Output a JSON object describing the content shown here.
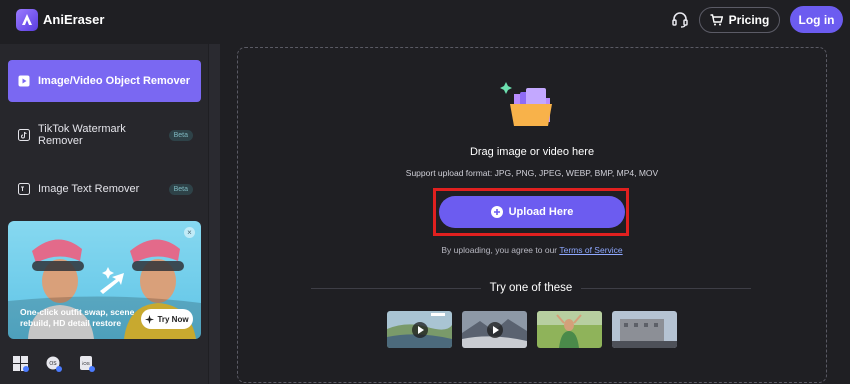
{
  "header": {
    "brand": "AniEraser",
    "pricing_label": "Pricing",
    "login_label": "Log in"
  },
  "sidebar": {
    "items": [
      {
        "label": "Image/Video Object Remover",
        "badge": "",
        "active": true
      },
      {
        "label": "TikTok Watermark Remover",
        "badge": "Beta",
        "active": false
      },
      {
        "label": "Image Text Remover",
        "badge": "Beta",
        "active": false
      }
    ],
    "promo": {
      "text": "One-click outfit swap, scene rebuild, HD detail restore",
      "button_label": "Try Now",
      "close_symbol": "×"
    },
    "platforms": [
      "windows-icon",
      "macos-icon",
      "ios-icon"
    ]
  },
  "upload": {
    "drag_text": "Drag image or video here",
    "format_text": "Support upload format: JPG, PNG, JPEG, WEBP, BMP, MP4, MOV",
    "button_label": "Upload Here",
    "terms_prefix": "By uploading, you agree to our ",
    "terms_link": "Terms of Service"
  },
  "examples": {
    "title": "Try one of these",
    "thumbs": [
      {
        "name": "coastal-road-video",
        "is_video": true
      },
      {
        "name": "mountain-clouds-video",
        "is_video": true
      },
      {
        "name": "woman-meadow-photo",
        "is_video": false
      },
      {
        "name": "city-building-photo",
        "is_video": false
      }
    ]
  },
  "colors": {
    "accent": "#6c5cf0",
    "sidebar_active": "#7a68f2",
    "highlight_box": "#e0201f",
    "background": "#1f1f23"
  }
}
